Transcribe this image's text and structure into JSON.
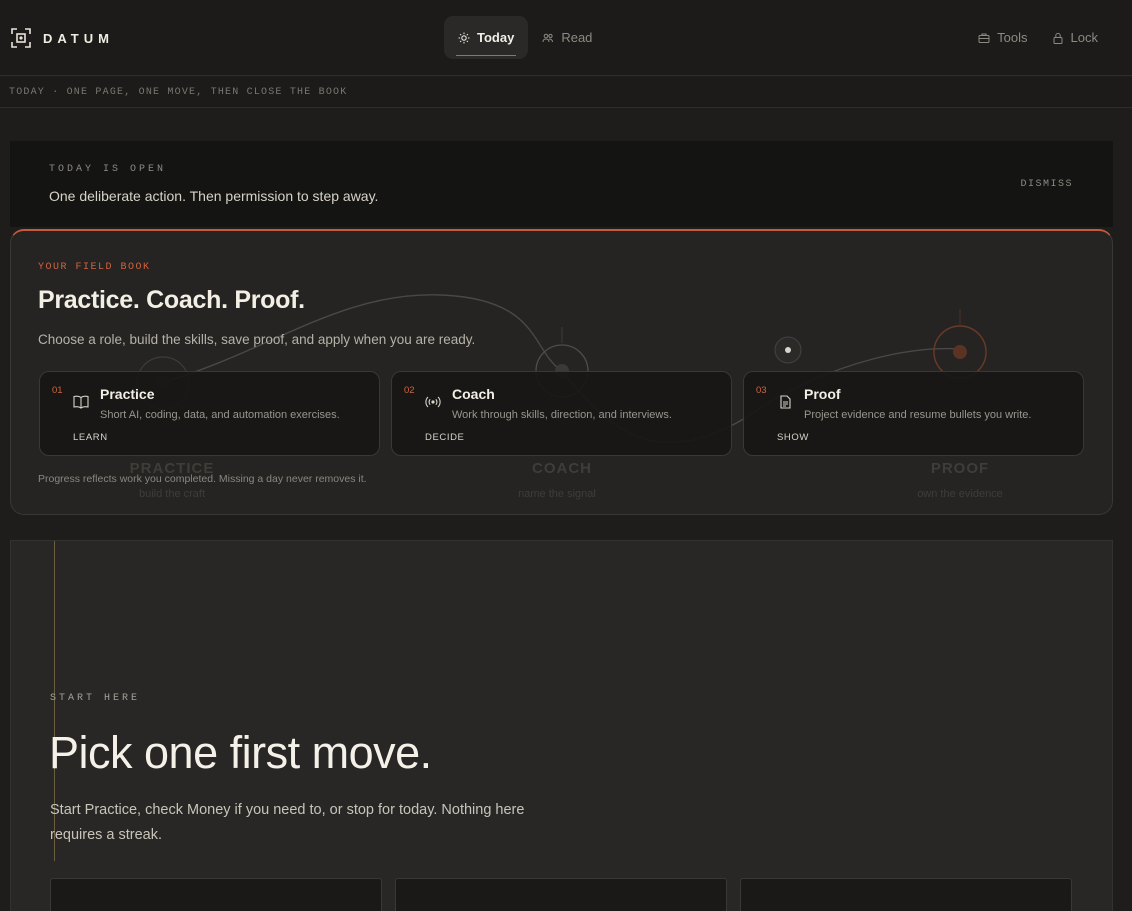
{
  "header": {
    "brand": "DATUM",
    "nav": [
      {
        "label": "Today",
        "icon": "sun-icon",
        "active": true
      },
      {
        "label": "Read",
        "icon": "people-icon",
        "active": false
      }
    ],
    "right_nav": [
      {
        "label": "Tools",
        "icon": "briefcase-icon"
      },
      {
        "label": "Lock",
        "icon": "lock-icon"
      }
    ]
  },
  "breadcrumb": "TODAY · ONE PAGE, ONE MOVE, THEN CLOSE THE BOOK",
  "notice": {
    "eyebrow": "TODAY IS OPEN",
    "message": "One deliberate action. Then permission to step away.",
    "dismiss": "DISMISS"
  },
  "field_book": {
    "eyebrow": "YOUR FIELD BOOK",
    "title": "Practice. Coach. Proof.",
    "subtitle": "Choose a role, build the skills, save proof, and apply when you are ready.",
    "cards": [
      {
        "num": "01",
        "icon": "book-icon",
        "title": "Practice",
        "desc": "Short AI, coding, data, and automation exercises.",
        "foot": "LEARN"
      },
      {
        "num": "02",
        "icon": "broadcast-icon",
        "title": "Coach",
        "desc": "Work through skills, direction, and interviews.",
        "foot": "DECIDE"
      },
      {
        "num": "03",
        "icon": "document-icon",
        "title": "Proof",
        "desc": "Project evidence and resume bullets you write.",
        "foot": "SHOW"
      }
    ],
    "note": "Progress reflects work you completed. Missing a day never removes it.",
    "ghost_labels": [
      {
        "label": "PRACTICE",
        "sub": "build the craft"
      },
      {
        "label": "COACH",
        "sub": "name the signal"
      },
      {
        "label": "PROOF",
        "sub": "own the evidence"
      }
    ]
  },
  "start": {
    "eyebrow": "START HERE",
    "title": "Pick one first move.",
    "paragraph": "Start Practice, check Money if you need to, or stop for today. Nothing here requires a streak."
  },
  "colors": {
    "accent": "#d0643f",
    "background": "#1e1d1b",
    "card": "#181716"
  }
}
